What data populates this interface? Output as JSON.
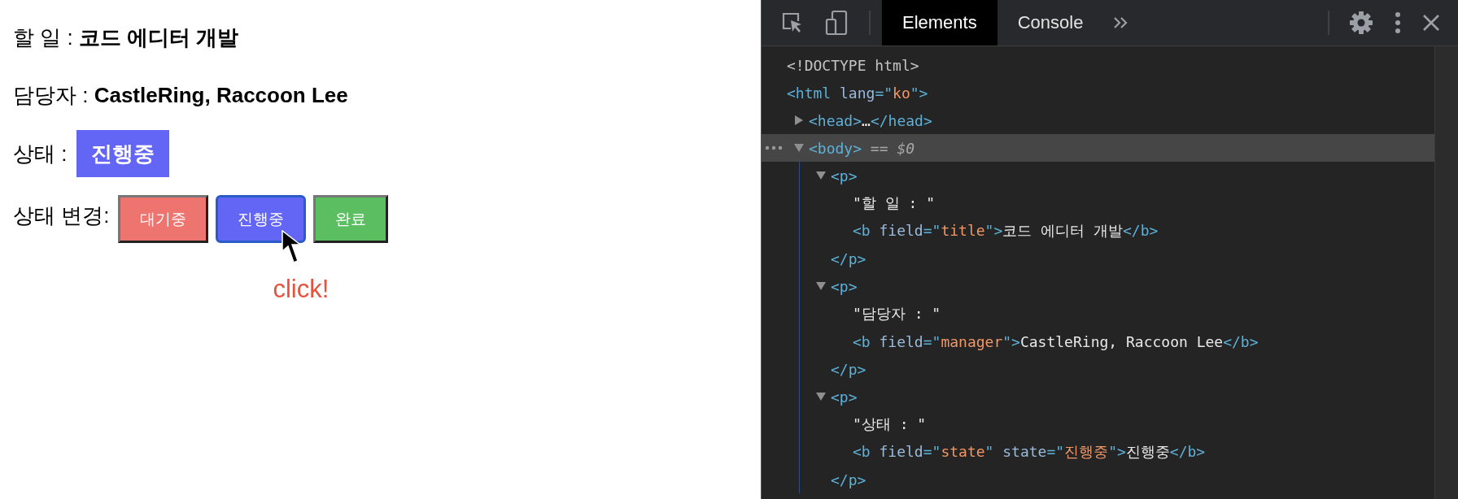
{
  "page": {
    "lines": [
      {
        "kind": "text",
        "text": "할 일 : **코드 에디터 개발**"
      },
      {
        "kind": "text",
        "text": "담당자 : **CastleRing, Raccoon Lee**"
      },
      {
        "kind": "badge",
        "label": "상태 :",
        "badge": "진행중"
      },
      {
        "kind": "buttons",
        "label": "상태 변경:",
        "buttons": [
          {
            "label": "대기중",
            "color": "#ee7470",
            "selected": false
          },
          {
            "label": "진행중",
            "color": "#6366f5",
            "selected": true
          },
          {
            "label": "완료",
            "color": "#5bbf62",
            "selected": false
          }
        ]
      }
    ],
    "annotation": "click!"
  },
  "devtools": {
    "tabs": [
      {
        "label": "Elements",
        "selected": true
      },
      {
        "label": "Console",
        "selected": false
      }
    ],
    "dom": [
      {
        "selected": false,
        "line": [
          {
            "kind": "doctype",
            "text": "<!DOCTYPE html>"
          }
        ]
      },
      {
        "selected": false,
        "line": [
          {
            "kind": "tag",
            "text": "<html "
          },
          {
            "kind": "attr",
            "text": "lang"
          },
          {
            "kind": "tag",
            "text": "=\""
          },
          {
            "kind": "value",
            "text": "ko"
          },
          {
            "kind": "tag",
            "text": "\">"
          }
        ],
        "children": [
          {
            "selected": false,
            "expanded": false,
            "line": [
              {
                "kind": "tag",
                "text": "<head>"
              },
              {
                "kind": "text",
                "text": "…"
              },
              {
                "kind": "tag",
                "text": "</head>"
              }
            ]
          },
          {
            "selected": true,
            "expanded": true,
            "line": [
              {
                "kind": "tag",
                "text": "<body>"
              },
              {
                "kind": "note",
                "text": " == "
              },
              {
                "kind": "var",
                "text": "$0"
              }
            ],
            "children": [
              {
                "selected": false,
                "expanded": true,
                "line": [
                  {
                    "kind": "tag",
                    "text": "<p>"
                  }
                ],
                "close": [
                  {
                    "kind": "tag",
                    "text": "</p>"
                  }
                ],
                "children": [
                  {
                    "selected": false,
                    "line": [
                      {
                        "kind": "text",
                        "text": "\"할 일 : \""
                      }
                    ]
                  },
                  {
                    "selected": false,
                    "line": [
                      {
                        "kind": "tag",
                        "text": "<b "
                      },
                      {
                        "kind": "attr",
                        "text": "field"
                      },
                      {
                        "kind": "tag",
                        "text": "=\""
                      },
                      {
                        "kind": "value",
                        "text": "title"
                      },
                      {
                        "kind": "tag",
                        "text": "\">"
                      },
                      {
                        "kind": "text",
                        "text": "코드 에디터 개발"
                      },
                      {
                        "kind": "tag",
                        "text": "</b>"
                      }
                    ]
                  }
                ]
              },
              {
                "selected": false,
                "expanded": true,
                "line": [
                  {
                    "kind": "tag",
                    "text": "<p>"
                  }
                ],
                "close": [
                  {
                    "kind": "tag",
                    "text": "</p>"
                  }
                ],
                "children": [
                  {
                    "selected": false,
                    "line": [
                      {
                        "kind": "text",
                        "text": "\"담당자 : \""
                      }
                    ]
                  },
                  {
                    "selected": false,
                    "line": [
                      {
                        "kind": "tag",
                        "text": "<b "
                      },
                      {
                        "kind": "attr",
                        "text": "field"
                      },
                      {
                        "kind": "tag",
                        "text": "=\""
                      },
                      {
                        "kind": "value",
                        "text": "manager"
                      },
                      {
                        "kind": "tag",
                        "text": "\">"
                      },
                      {
                        "kind": "text",
                        "text": "CastleRing, Raccoon Lee"
                      },
                      {
                        "kind": "tag",
                        "text": "</b>"
                      }
                    ]
                  }
                ]
              },
              {
                "selected": false,
                "expanded": true,
                "line": [
                  {
                    "kind": "tag",
                    "text": "<p>"
                  }
                ],
                "close": [
                  {
                    "kind": "tag",
                    "text": "</p>"
                  }
                ],
                "children": [
                  {
                    "selected": false,
                    "line": [
                      {
                        "kind": "text",
                        "text": "\"상태 : \""
                      }
                    ]
                  },
                  {
                    "selected": false,
                    "line": [
                      {
                        "kind": "tag",
                        "text": "<b "
                      },
                      {
                        "kind": "attr",
                        "text": "field"
                      },
                      {
                        "kind": "tag",
                        "text": "=\""
                      },
                      {
                        "kind": "value",
                        "text": "state"
                      },
                      {
                        "kind": "tag",
                        "text": "\" "
                      },
                      {
                        "kind": "attr",
                        "text": "state"
                      },
                      {
                        "kind": "tag",
                        "text": "=\""
                      },
                      {
                        "kind": "value",
                        "text": "진행중"
                      },
                      {
                        "kind": "tag",
                        "text": "\">"
                      },
                      {
                        "kind": "text",
                        "text": "진행중"
                      },
                      {
                        "kind": "tag",
                        "text": "</b>"
                      }
                    ]
                  }
                ]
              }
            ]
          }
        ]
      }
    ]
  }
}
